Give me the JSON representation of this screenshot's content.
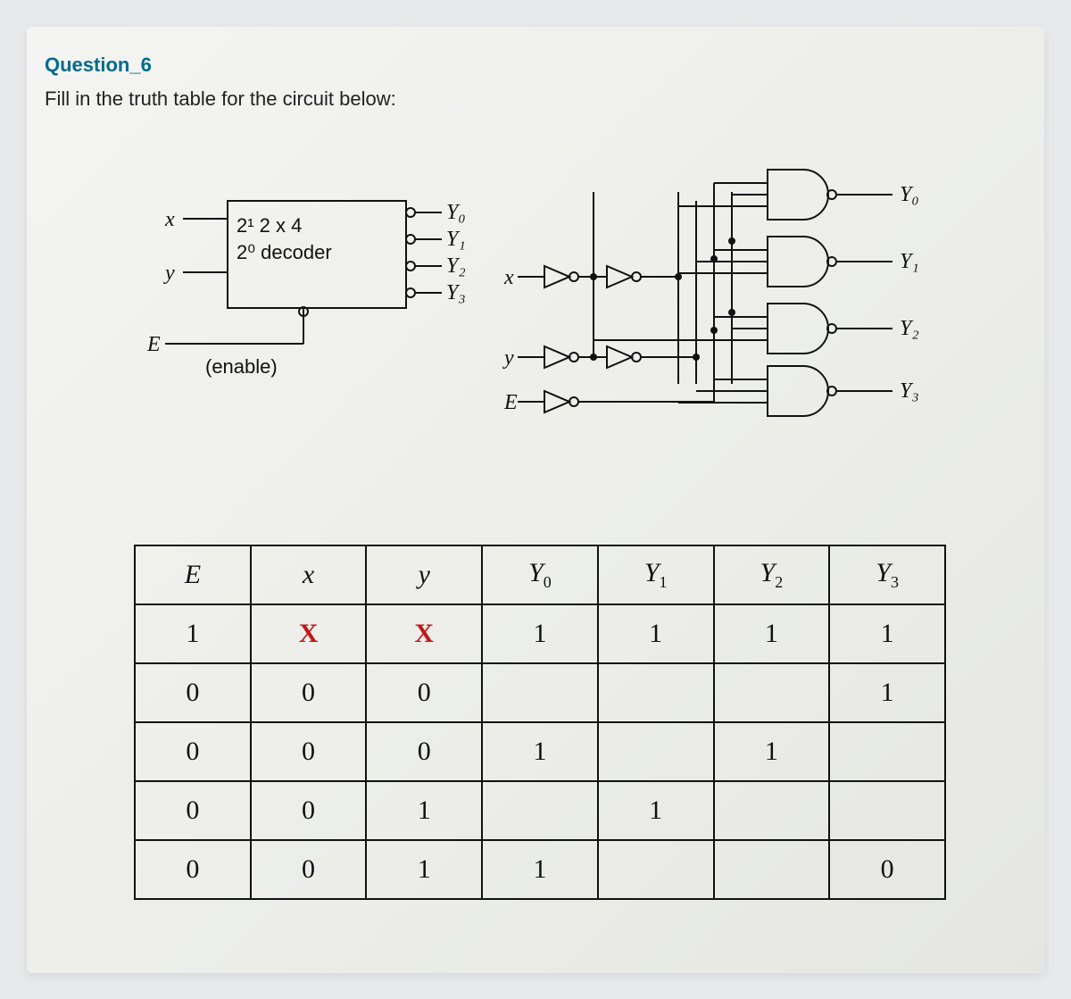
{
  "question": {
    "title": "Question_6",
    "prompt": "Fill in the truth table for the circuit below:"
  },
  "decoder": {
    "input_x": "x",
    "input_y": "y",
    "input_E": "E",
    "line1": "2¹ 2 x 4",
    "line2": "2⁰ decoder",
    "enable_label": "(enable)",
    "outputs": [
      "Y₀",
      "Y₁",
      "Y₂",
      "Y₃"
    ]
  },
  "gate_labels": {
    "x": "x",
    "y": "y",
    "E": "E",
    "Y0": "Y₀",
    "Y1": "Y₁",
    "Y2": "Y₂",
    "Y3": "Y₃"
  },
  "table": {
    "headers": [
      "E",
      "x",
      "y",
      "Y₀",
      "Y₁",
      "Y₂",
      "Y₃"
    ],
    "rows": [
      [
        "1",
        "X",
        "X",
        "1",
        "1",
        "1",
        "1"
      ],
      [
        "0",
        "0",
        "0",
        "",
        "",
        "",
        "1"
      ],
      [
        "0",
        "0",
        "0",
        "1",
        "",
        "1",
        ""
      ],
      [
        "0",
        "0",
        "1",
        "",
        "1",
        "",
        ""
      ],
      [
        "0",
        "0",
        "1",
        "1",
        "",
        "",
        "0"
      ]
    ],
    "red_cells": [
      [
        0,
        1
      ],
      [
        0,
        2
      ]
    ]
  }
}
